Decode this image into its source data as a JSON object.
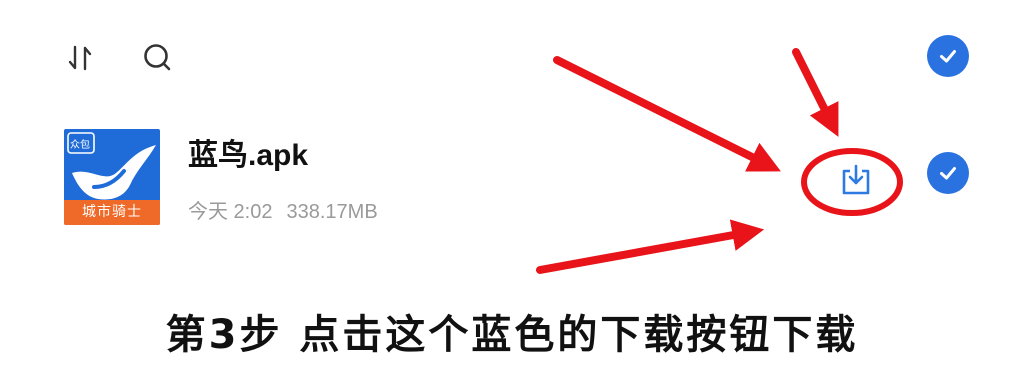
{
  "toolbar": {
    "icons": [
      "sort-icon",
      "search-icon"
    ]
  },
  "file": {
    "name": "蓝鸟.apk",
    "date": "今天 2:02",
    "size": "338.17MB",
    "icon_brand_text": "城市骑士",
    "icon_tag": "众包",
    "download_icon": "download-icon"
  },
  "annotation": {
    "caption": "第3步 点击这个蓝色的下载按钮下载"
  },
  "colors": {
    "accent_blue": "#2d7be2",
    "check_blue": "#2a72e0",
    "annotation_red": "#e8141a",
    "icon_blue": "#1f6bd8",
    "icon_orange": "#ef6a29",
    "meta_gray": "#9a9a9a"
  }
}
